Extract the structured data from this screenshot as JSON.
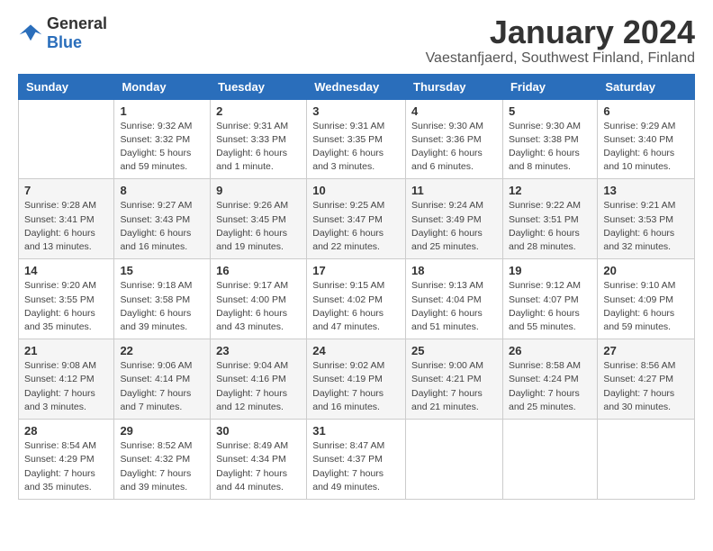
{
  "logo": {
    "text_general": "General",
    "text_blue": "Blue"
  },
  "header": {
    "month_year": "January 2024",
    "location": "Vaestanfjaerd, Southwest Finland, Finland"
  },
  "weekdays": [
    "Sunday",
    "Monday",
    "Tuesday",
    "Wednesday",
    "Thursday",
    "Friday",
    "Saturday"
  ],
  "weeks": [
    [
      {
        "day": "",
        "sunrise": "",
        "sunset": "",
        "daylight": ""
      },
      {
        "day": "1",
        "sunrise": "Sunrise: 9:32 AM",
        "sunset": "Sunset: 3:32 PM",
        "daylight": "Daylight: 5 hours and 59 minutes."
      },
      {
        "day": "2",
        "sunrise": "Sunrise: 9:31 AM",
        "sunset": "Sunset: 3:33 PM",
        "daylight": "Daylight: 6 hours and 1 minute."
      },
      {
        "day": "3",
        "sunrise": "Sunrise: 9:31 AM",
        "sunset": "Sunset: 3:35 PM",
        "daylight": "Daylight: 6 hours and 3 minutes."
      },
      {
        "day": "4",
        "sunrise": "Sunrise: 9:30 AM",
        "sunset": "Sunset: 3:36 PM",
        "daylight": "Daylight: 6 hours and 6 minutes."
      },
      {
        "day": "5",
        "sunrise": "Sunrise: 9:30 AM",
        "sunset": "Sunset: 3:38 PM",
        "daylight": "Daylight: 6 hours and 8 minutes."
      },
      {
        "day": "6",
        "sunrise": "Sunrise: 9:29 AM",
        "sunset": "Sunset: 3:40 PM",
        "daylight": "Daylight: 6 hours and 10 minutes."
      }
    ],
    [
      {
        "day": "7",
        "sunrise": "Sunrise: 9:28 AM",
        "sunset": "Sunset: 3:41 PM",
        "daylight": "Daylight: 6 hours and 13 minutes."
      },
      {
        "day": "8",
        "sunrise": "Sunrise: 9:27 AM",
        "sunset": "Sunset: 3:43 PM",
        "daylight": "Daylight: 6 hours and 16 minutes."
      },
      {
        "day": "9",
        "sunrise": "Sunrise: 9:26 AM",
        "sunset": "Sunset: 3:45 PM",
        "daylight": "Daylight: 6 hours and 19 minutes."
      },
      {
        "day": "10",
        "sunrise": "Sunrise: 9:25 AM",
        "sunset": "Sunset: 3:47 PM",
        "daylight": "Daylight: 6 hours and 22 minutes."
      },
      {
        "day": "11",
        "sunrise": "Sunrise: 9:24 AM",
        "sunset": "Sunset: 3:49 PM",
        "daylight": "Daylight: 6 hours and 25 minutes."
      },
      {
        "day": "12",
        "sunrise": "Sunrise: 9:22 AM",
        "sunset": "Sunset: 3:51 PM",
        "daylight": "Daylight: 6 hours and 28 minutes."
      },
      {
        "day": "13",
        "sunrise": "Sunrise: 9:21 AM",
        "sunset": "Sunset: 3:53 PM",
        "daylight": "Daylight: 6 hours and 32 minutes."
      }
    ],
    [
      {
        "day": "14",
        "sunrise": "Sunrise: 9:20 AM",
        "sunset": "Sunset: 3:55 PM",
        "daylight": "Daylight: 6 hours and 35 minutes."
      },
      {
        "day": "15",
        "sunrise": "Sunrise: 9:18 AM",
        "sunset": "Sunset: 3:58 PM",
        "daylight": "Daylight: 6 hours and 39 minutes."
      },
      {
        "day": "16",
        "sunrise": "Sunrise: 9:17 AM",
        "sunset": "Sunset: 4:00 PM",
        "daylight": "Daylight: 6 hours and 43 minutes."
      },
      {
        "day": "17",
        "sunrise": "Sunrise: 9:15 AM",
        "sunset": "Sunset: 4:02 PM",
        "daylight": "Daylight: 6 hours and 47 minutes."
      },
      {
        "day": "18",
        "sunrise": "Sunrise: 9:13 AM",
        "sunset": "Sunset: 4:04 PM",
        "daylight": "Daylight: 6 hours and 51 minutes."
      },
      {
        "day": "19",
        "sunrise": "Sunrise: 9:12 AM",
        "sunset": "Sunset: 4:07 PM",
        "daylight": "Daylight: 6 hours and 55 minutes."
      },
      {
        "day": "20",
        "sunrise": "Sunrise: 9:10 AM",
        "sunset": "Sunset: 4:09 PM",
        "daylight": "Daylight: 6 hours and 59 minutes."
      }
    ],
    [
      {
        "day": "21",
        "sunrise": "Sunrise: 9:08 AM",
        "sunset": "Sunset: 4:12 PM",
        "daylight": "Daylight: 7 hours and 3 minutes."
      },
      {
        "day": "22",
        "sunrise": "Sunrise: 9:06 AM",
        "sunset": "Sunset: 4:14 PM",
        "daylight": "Daylight: 7 hours and 7 minutes."
      },
      {
        "day": "23",
        "sunrise": "Sunrise: 9:04 AM",
        "sunset": "Sunset: 4:16 PM",
        "daylight": "Daylight: 7 hours and 12 minutes."
      },
      {
        "day": "24",
        "sunrise": "Sunrise: 9:02 AM",
        "sunset": "Sunset: 4:19 PM",
        "daylight": "Daylight: 7 hours and 16 minutes."
      },
      {
        "day": "25",
        "sunrise": "Sunrise: 9:00 AM",
        "sunset": "Sunset: 4:21 PM",
        "daylight": "Daylight: 7 hours and 21 minutes."
      },
      {
        "day": "26",
        "sunrise": "Sunrise: 8:58 AM",
        "sunset": "Sunset: 4:24 PM",
        "daylight": "Daylight: 7 hours and 25 minutes."
      },
      {
        "day": "27",
        "sunrise": "Sunrise: 8:56 AM",
        "sunset": "Sunset: 4:27 PM",
        "daylight": "Daylight: 7 hours and 30 minutes."
      }
    ],
    [
      {
        "day": "28",
        "sunrise": "Sunrise: 8:54 AM",
        "sunset": "Sunset: 4:29 PM",
        "daylight": "Daylight: 7 hours and 35 minutes."
      },
      {
        "day": "29",
        "sunrise": "Sunrise: 8:52 AM",
        "sunset": "Sunset: 4:32 PM",
        "daylight": "Daylight: 7 hours and 39 minutes."
      },
      {
        "day": "30",
        "sunrise": "Sunrise: 8:49 AM",
        "sunset": "Sunset: 4:34 PM",
        "daylight": "Daylight: 7 hours and 44 minutes."
      },
      {
        "day": "31",
        "sunrise": "Sunrise: 8:47 AM",
        "sunset": "Sunset: 4:37 PM",
        "daylight": "Daylight: 7 hours and 49 minutes."
      },
      {
        "day": "",
        "sunrise": "",
        "sunset": "",
        "daylight": ""
      },
      {
        "day": "",
        "sunrise": "",
        "sunset": "",
        "daylight": ""
      },
      {
        "day": "",
        "sunrise": "",
        "sunset": "",
        "daylight": ""
      }
    ]
  ]
}
